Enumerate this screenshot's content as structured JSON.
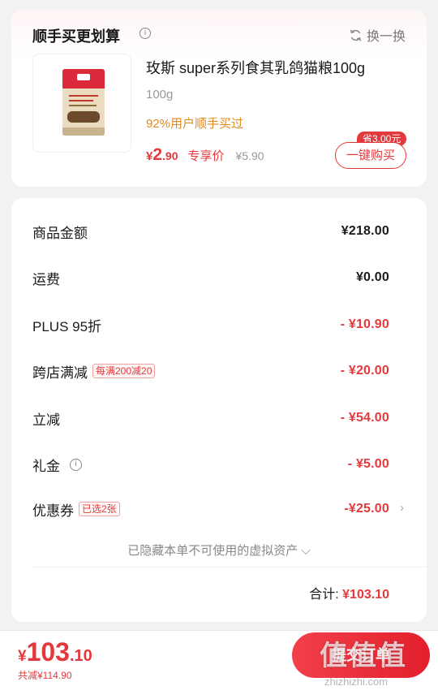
{
  "recommend": {
    "title": "顺手买更划算",
    "info_icon": "i",
    "swap_label": "换一换",
    "product": {
      "name": "玫斯 super系列食其乳鸽猫粮100g",
      "weight": "100g",
      "bought_text": "92%用户顺手买过",
      "price_yen": "¥",
      "price_int": "2",
      "price_dec": ".90",
      "price_tag": "专享价",
      "orig_price": "¥5.90",
      "save_badge": "省3.00元",
      "buy_label": "一键购买"
    }
  },
  "summary": {
    "rows": [
      {
        "label": "商品金额",
        "value": "¥218.00"
      },
      {
        "label": "运费",
        "value": "¥0.00"
      },
      {
        "label": "PLUS 95折",
        "value": "- ¥10.90"
      },
      {
        "label": "跨店满减",
        "tag": "每满200减20",
        "value": "- ¥20.00"
      },
      {
        "label": "立减",
        "value": "- ¥54.00"
      },
      {
        "label": "礼金",
        "info_icon": "i",
        "value": "- ¥5.00"
      },
      {
        "label": "优惠券",
        "tag": "已选2张",
        "value": "-¥25.00",
        "chevron": "›"
      }
    ],
    "hidden_note": "已隐藏本单不可使用的虚拟资产 ⌵",
    "total_label": "合计:",
    "total_value": "¥103.10"
  },
  "bottom": {
    "price_yen": "¥",
    "price_int": "103",
    "price_dec": ".10",
    "saved_text": "共减¥114.90",
    "submit_label": "提交订单"
  },
  "watermark": {
    "text": "值值值",
    "url": "zhizhizhi.com"
  },
  "colors": {
    "accent": "#e4393c",
    "orange": "#e08a1e",
    "background": "#f2f2f2"
  }
}
